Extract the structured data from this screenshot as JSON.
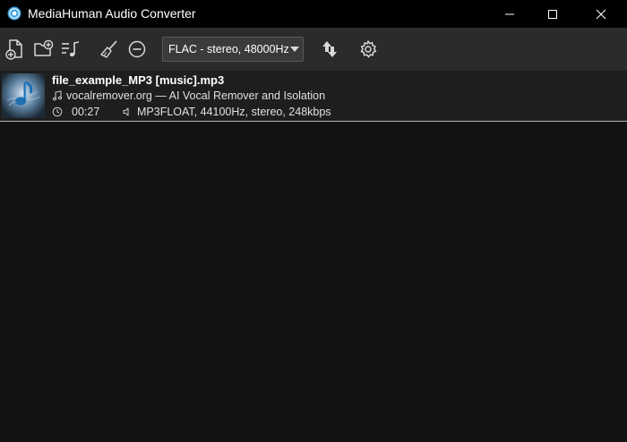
{
  "window": {
    "title": "MediaHuman Audio Converter",
    "app_icon": "mediahuman-logo-icon",
    "controls": [
      "minimize-icon",
      "maximize-icon",
      "close-icon"
    ]
  },
  "toolbar": {
    "buttons": [
      {
        "name": "add-file-button",
        "icon": "add-file-icon"
      },
      {
        "name": "add-folder-button",
        "icon": "add-folder-icon"
      },
      {
        "name": "add-playlist-button",
        "icon": "add-music-icon"
      },
      {
        "name": "clear-list-button",
        "icon": "broom-icon"
      },
      {
        "name": "remove-item-button",
        "icon": "minus-circle-icon"
      },
      {
        "name": "convert-button",
        "icon": "convert-arrows-icon"
      },
      {
        "name": "settings-button",
        "icon": "gear-icon"
      }
    ],
    "format_select": {
      "value": "FLAC - stereo, 48000Hz"
    }
  },
  "files": [
    {
      "name": "file_example_MP3 [music].mp3",
      "artist": "vocalremover.org — AI Vocal Remover and Isolation",
      "duration": "00:27",
      "format": "MP3FLOAT, 44100Hz, stereo, 248kbps"
    }
  ],
  "colors": {
    "titlebar": "#000000",
    "toolbar": "#2b2b2b",
    "list_background": "#131313",
    "row_background": "#1e1e1e",
    "accent": "#3aa0e0"
  }
}
